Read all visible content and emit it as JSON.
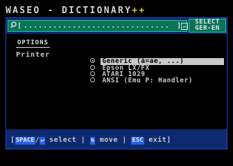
{
  "app": {
    "title": "WASEO - DICTIONARY",
    "title_plus": "++"
  },
  "search": {
    "bracket_left": "[",
    "bracket_right": "]",
    "placeholder": "..............................",
    "enter_icon": "↵"
  },
  "language_selector": {
    "line1": "SELECT",
    "line2": "GER-EN"
  },
  "options": {
    "tab_label": "OPTIONS",
    "printer_label": "Printer",
    "printers": [
      {
        "label": "Generic (ä=ae, ...)",
        "selected": true
      },
      {
        "label": "Epson LX/FX",
        "selected": false
      },
      {
        "label": "ATARI 1029",
        "selected": false
      },
      {
        "label": "ANSI (Emu P: Handler)",
        "selected": false
      }
    ]
  },
  "statusbar": {
    "key_space": "SPACE",
    "sep": "/",
    "key_enter": "↵",
    "select_text": " select ",
    "key_updown": "⇅",
    "move_text": " move ",
    "key_esc": "ESC",
    "exit_text": " exit"
  },
  "colors": {
    "background": "#000000",
    "screen_blue": "#0d2a70",
    "field_green": "#0a735a",
    "key_blue": "#2a63e0",
    "title_plus_yellow": "#d4d030"
  }
}
